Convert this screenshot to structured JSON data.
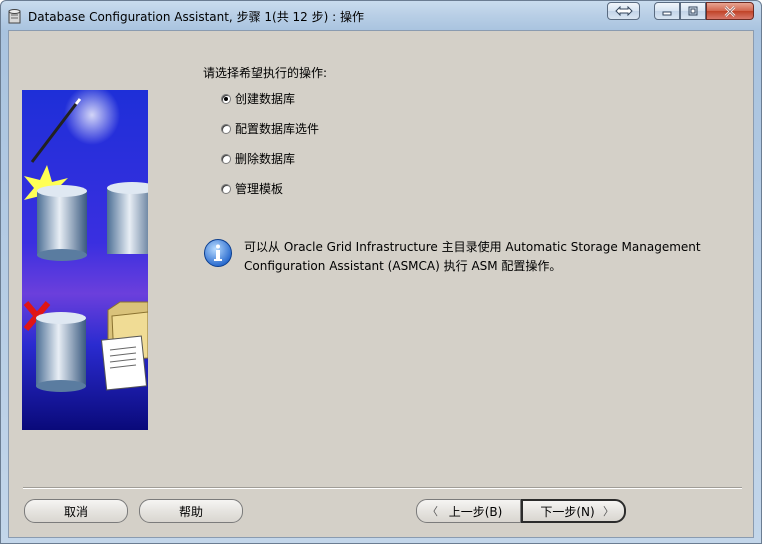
{
  "window": {
    "title": "Database Configuration Assistant, 步骤 1(共 12 步) : 操作"
  },
  "content": {
    "prompt": "请选择希望执行的操作:",
    "options": [
      {
        "label": "创建数据库",
        "selected": true
      },
      {
        "label": "配置数据库选件",
        "selected": false
      },
      {
        "label": "删除数据库",
        "selected": false
      },
      {
        "label": "管理模板",
        "selected": false
      }
    ],
    "info_text": "可以从 Oracle Grid Infrastructure 主目录使用 Automatic Storage Management Configuration Assistant (ASMCA) 执行 ASM 配置操作。"
  },
  "buttons": {
    "cancel": "取消",
    "help": "帮助",
    "back": "上一步(B)",
    "next": "下一步(N)"
  },
  "icons": {
    "app": "database-app-icon",
    "info": "info-icon",
    "back_arrow": "chevron-left-icon",
    "next_arrow": "chevron-right-icon"
  }
}
